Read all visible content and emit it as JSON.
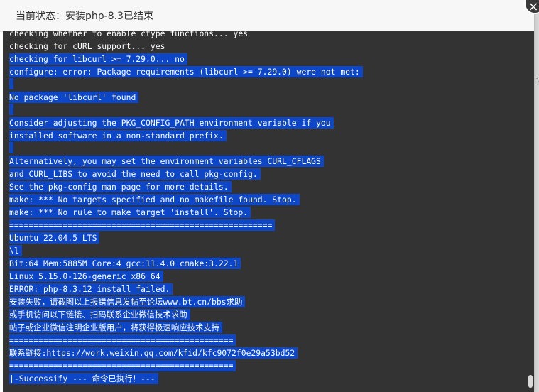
{
  "dialog": {
    "title": "当前状态：安装php-8.3已结束",
    "close_icon": "×"
  },
  "terminal": {
    "lines": [
      {
        "text": "checking whether to enable ctype functions... yes",
        "selected": false
      },
      {
        "text": "checking for cURL support... yes",
        "selected": false
      },
      {
        "text": "checking for libcurl >= 7.29.0... no",
        "selected": true
      },
      {
        "text": "configure: error: Package requirements (libcurl >= 7.29.0) were not met:",
        "selected": true
      },
      {
        "text": "",
        "selected": true
      },
      {
        "text": "No package 'libcurl' found",
        "selected": true
      },
      {
        "text": "",
        "selected": true
      },
      {
        "text": "Consider adjusting the PKG_CONFIG_PATH environment variable if you",
        "selected": true
      },
      {
        "text": "installed software in a non-standard prefix.",
        "selected": true
      },
      {
        "text": "",
        "selected": true
      },
      {
        "text": "Alternatively, you may set the environment variables CURL_CFLAGS",
        "selected": true
      },
      {
        "text": "and CURL_LIBS to avoid the need to call pkg-config.",
        "selected": true
      },
      {
        "text": "See the pkg-config man page for more details.",
        "selected": true
      },
      {
        "text": "make: *** No targets specified and no makefile found. Stop.",
        "selected": true
      },
      {
        "text": "make: *** No rule to make target 'install'. Stop.",
        "selected": true
      },
      {
        "text": "======================================================",
        "selected": true
      },
      {
        "text": "Ubuntu 22.04.5 LTS",
        "selected": true
      },
      {
        "text": "\\l",
        "selected": true
      },
      {
        "text": "Bit:64 Mem:5885M Core:4 gcc:11.4.0 cmake:3.22.1",
        "selected": true
      },
      {
        "text": "Linux 5.15.0-126-generic x86_64",
        "selected": true
      },
      {
        "text": "ERROR: php-8.3.12 install failed.",
        "selected": true
      },
      {
        "text": "安装失败，请截图以上报错信息发帖至论坛www.bt.cn/bbs求助",
        "selected": true
      },
      {
        "text": "或手机访问以下链接、扫码联系企业微信技术求助",
        "selected": true
      },
      {
        "text": "帖子或企业微信注明企业版用户，将获得极速响应技术支持",
        "selected": true
      },
      {
        "text": "==============================================",
        "selected": true
      },
      {
        "text": "联系链接:https://work.weixin.qq.com/kfid/kfc9072f0e29a53bd52",
        "selected": true
      },
      {
        "text": "==============================================",
        "selected": true
      },
      {
        "text": "|-Successify --- 命令已执行！---",
        "selected": true
      }
    ]
  },
  "background": {
    "fragment": "})"
  }
}
